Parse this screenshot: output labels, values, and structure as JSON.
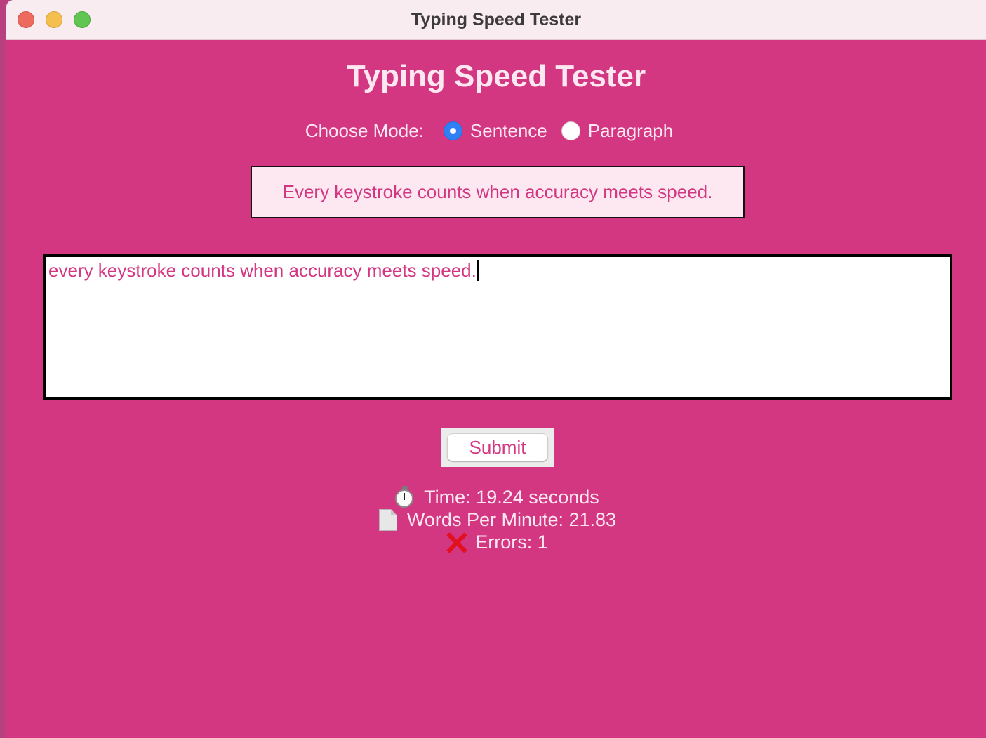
{
  "window": {
    "title": "Typing Speed Tester"
  },
  "app": {
    "heading": "Typing Speed Tester"
  },
  "mode": {
    "label": "Choose Mode:",
    "options": [
      {
        "label": "Sentence",
        "selected": true
      },
      {
        "label": "Paragraph",
        "selected": false
      }
    ]
  },
  "prompt": {
    "text": "Every keystroke counts when accuracy meets speed."
  },
  "input": {
    "value": "every keystroke counts when accuracy meets speed."
  },
  "submit": {
    "label": "Submit"
  },
  "results": {
    "time": {
      "icon": "stopwatch-icon",
      "text": "Time: 19.24 seconds"
    },
    "wpm": {
      "icon": "document-icon",
      "text": "Words Per Minute: 21.83"
    },
    "errors": {
      "icon": "cross-mark-icon",
      "text": "Errors: 1"
    }
  },
  "colors": {
    "background": "#d33782",
    "text_light": "#fde7f0",
    "accent": "#d33782",
    "radio_selected": "#2f7ff5",
    "error_red": "#e3101f"
  }
}
